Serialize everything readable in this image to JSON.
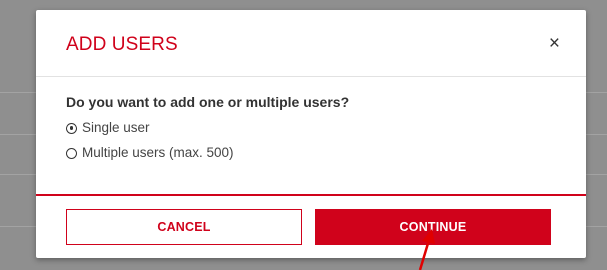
{
  "dialog": {
    "title": "ADD USERS",
    "close_label": "×",
    "question": "Do you want to add one or multiple users?",
    "options": [
      {
        "label": "Single user",
        "selected": true
      },
      {
        "label": "Multiple users (max. 500)",
        "selected": false
      }
    ],
    "cancel_label": "CANCEL",
    "continue_label": "CONTINUE"
  },
  "colors": {
    "accent": "#d0021b",
    "backdrop": "#8f8f8f"
  },
  "pointer": {
    "icon": "red-arrow-cursor-icon",
    "color": "#e00000"
  }
}
